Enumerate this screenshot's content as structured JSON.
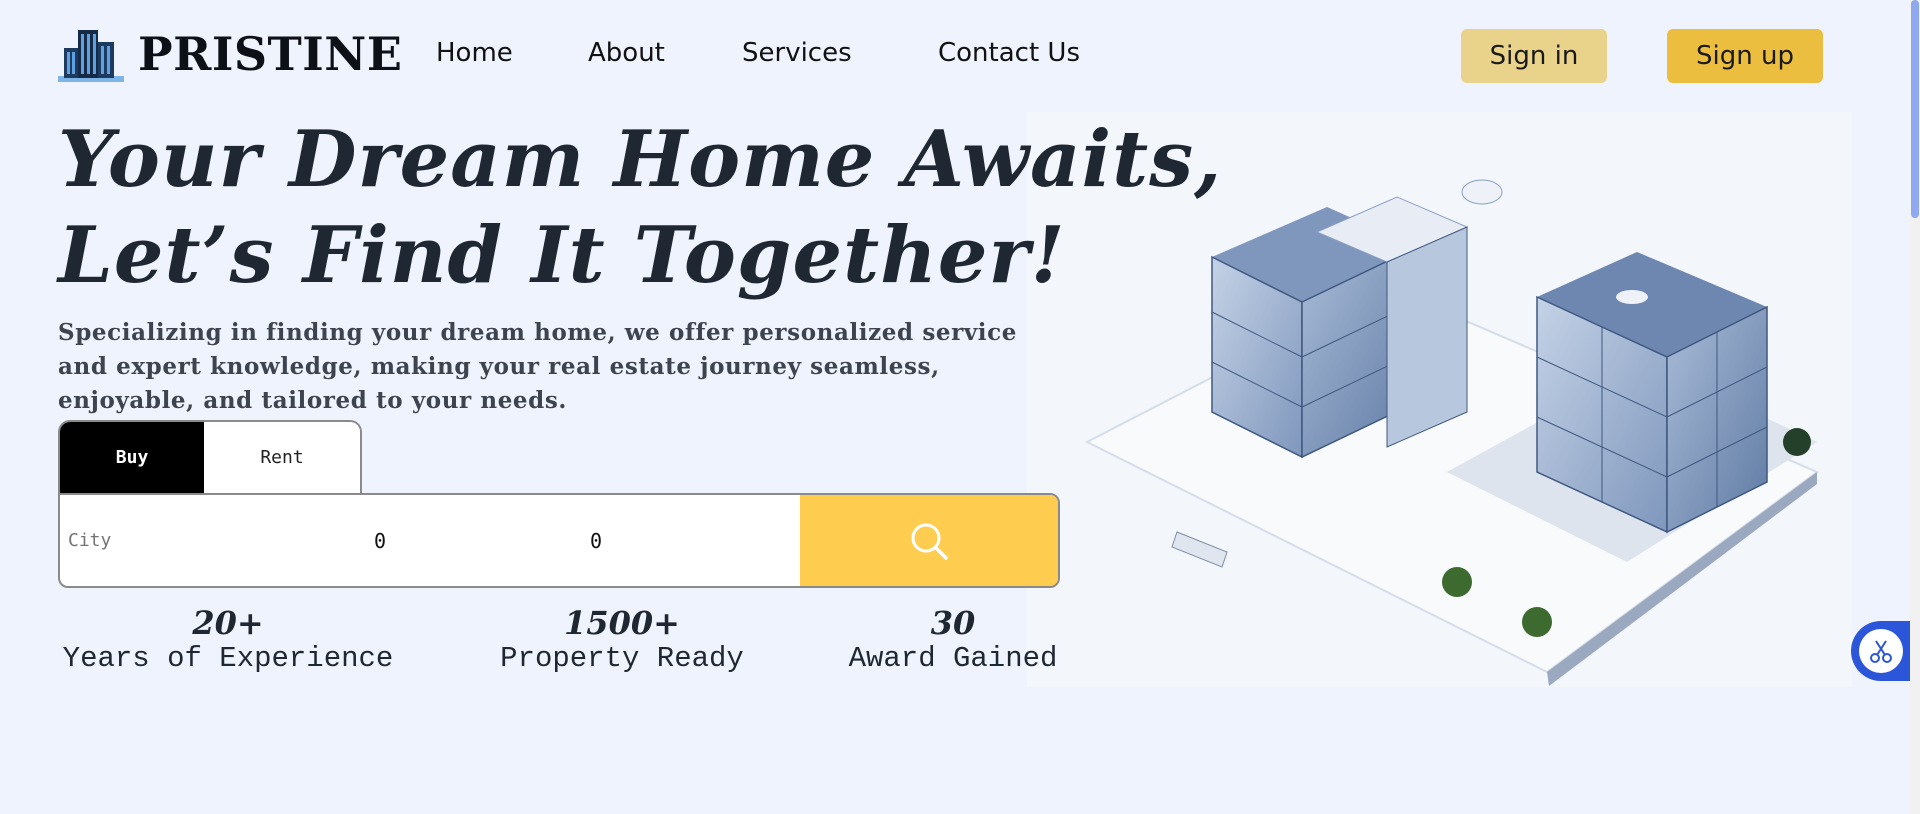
{
  "brand": {
    "name": "PRISTINE",
    "logo_icon": "buildings-icon"
  },
  "nav": {
    "items": [
      {
        "label": "Home"
      },
      {
        "label": "About"
      },
      {
        "label": "Services"
      },
      {
        "label": "Contact Us"
      }
    ]
  },
  "auth": {
    "signin_label": "Sign in",
    "signup_label": "Sign up"
  },
  "hero": {
    "title_line1": "Your Dream Home Awaits,",
    "title_line2": "Let’s Find It Together!",
    "description": "Specializing in finding your dream home, we offer personalized service and expert knowledge, making your real estate journey seamless, enjoyable, and tailored to your needs."
  },
  "search": {
    "tabs": [
      {
        "label": "Buy",
        "active": true
      },
      {
        "label": "Rent",
        "active": false
      }
    ],
    "city_placeholder": "City",
    "min_price": "0",
    "max_price": "0",
    "search_icon": "search-icon"
  },
  "stats": [
    {
      "value": "20+",
      "label": "Years of Experience"
    },
    {
      "value": "1500+",
      "label": "Property Ready"
    },
    {
      "value": "30",
      "label": "Award Gained"
    }
  ],
  "colors": {
    "background": "#eff3fd",
    "signin_bg": "#e9d38a",
    "signup_bg": "#ecbe3f",
    "search_button": "#fecd50",
    "text_dark": "#1f2733",
    "float_button": "#2b56d9"
  },
  "floating_widget": {
    "icon": "scissors-icon"
  }
}
